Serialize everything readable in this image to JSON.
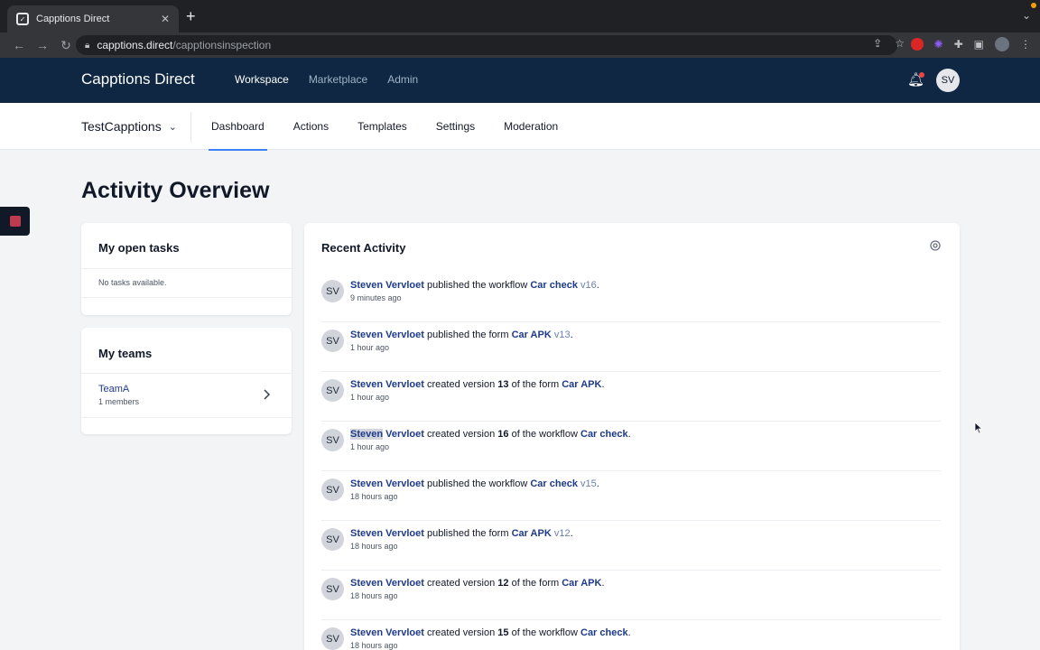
{
  "browser": {
    "tab_title": "Capptions Direct",
    "url_host": "capptions.direct",
    "url_path": "/capptionsinspection"
  },
  "header": {
    "brand": "Capptions Direct",
    "nav": [
      "Workspace",
      "Marketplace",
      "Admin"
    ],
    "avatar": "SV"
  },
  "subnav": {
    "workspace": "TestCapptions",
    "tabs": [
      "Dashboard",
      "Actions",
      "Templates",
      "Settings",
      "Moderation"
    ]
  },
  "page": {
    "title": "Activity Overview"
  },
  "tasks": {
    "title": "My open tasks",
    "empty": "No tasks available."
  },
  "teams": {
    "title": "My teams",
    "items": [
      {
        "name": "TeamA",
        "sub": "1 members"
      }
    ]
  },
  "activity": {
    "title": "Recent Activity",
    "items": [
      {
        "avatar": "SV",
        "user": "Steven Vervloet",
        "text_a": " published the workflow ",
        "obj": "Car check",
        "ver": " v16",
        "text_b": ".",
        "time": "9 minutes ago"
      },
      {
        "avatar": "SV",
        "user": "Steven Vervloet",
        "text_a": " published the form ",
        "obj": "Car APK",
        "ver": " v13",
        "text_b": ".",
        "time": "1 hour ago"
      },
      {
        "avatar": "SV",
        "user": "Steven Vervloet",
        "text_a": " created version ",
        "num": "13",
        "text_m": " of the form ",
        "obj": "Car APK",
        "text_b": ".",
        "time": "1 hour ago"
      },
      {
        "avatar": "SV",
        "user_first": "Steven",
        "user_last": " Vervloet",
        "text_a": " created version ",
        "num": "16",
        "text_m": " of the workflow ",
        "obj": "Car check",
        "text_b": ".",
        "time": "1 hour ago"
      },
      {
        "avatar": "SV",
        "user": "Steven Vervloet",
        "text_a": " published the workflow ",
        "obj": "Car check",
        "ver": " v15",
        "text_b": ".",
        "time": "18 hours ago"
      },
      {
        "avatar": "SV",
        "user": "Steven Vervloet",
        "text_a": " published the form ",
        "obj": "Car APK",
        "ver": " v12",
        "text_b": ".",
        "time": "18 hours ago"
      },
      {
        "avatar": "SV",
        "user": "Steven Vervloet",
        "text_a": " created version ",
        "num": "12",
        "text_m": " of the form ",
        "obj": "Car APK",
        "text_b": ".",
        "time": "18 hours ago"
      },
      {
        "avatar": "SV",
        "user": "Steven Vervloet",
        "text_a": " created version ",
        "num": "15",
        "text_m": " of the workflow ",
        "obj": "Car check",
        "text_b": ".",
        "time": "18 hours ago"
      }
    ]
  },
  "colors": {
    "header_bg": "#0f2742",
    "link": "#1e3a8a",
    "accent": "#3b82f6"
  }
}
